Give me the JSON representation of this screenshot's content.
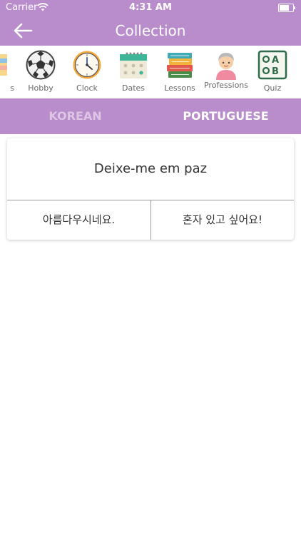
{
  "status_bar": {
    "carrier": "Carrier",
    "time": "4:31 AM"
  },
  "nav": {
    "title": "Collection",
    "back_icon": "arrow-left-icon"
  },
  "categories": [
    {
      "label": "s",
      "icon": "partial-icon"
    },
    {
      "label": "Hobby",
      "icon": "soccer-ball-icon"
    },
    {
      "label": "Clock",
      "icon": "clock-icon"
    },
    {
      "label": "Dates",
      "icon": "calendar-icon"
    },
    {
      "label": "Lessons",
      "icon": "books-icon"
    },
    {
      "label": "Professions",
      "icon": "person-icon"
    },
    {
      "label": "Quiz",
      "icon": "quiz-abc-icon"
    }
  ],
  "languages": {
    "left": "KOREAN",
    "right": "PORTUGUESE",
    "active": "PORTUGUESE"
  },
  "card": {
    "question": "Deixe-me em paz",
    "answers": [
      "아름다우시네요.",
      "혼자 있고 싶어요!"
    ]
  },
  "colors": {
    "accent": "#b98ccb",
    "inactive_tab": "#dcc6e4"
  }
}
